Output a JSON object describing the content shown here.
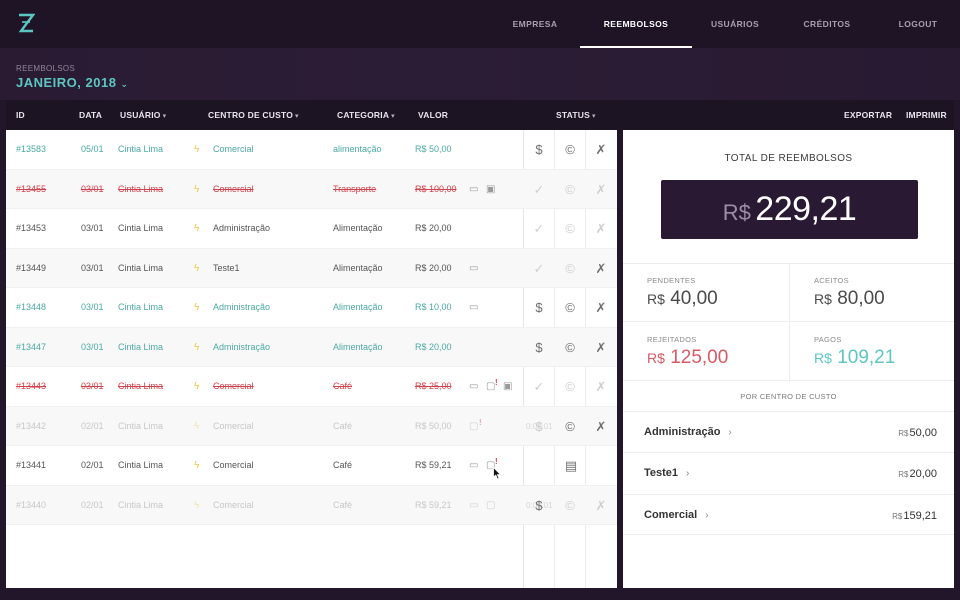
{
  "nav": {
    "items": [
      {
        "label": "EMPRESA",
        "active": false
      },
      {
        "label": "REEMBOLSOS",
        "active": true
      },
      {
        "label": "USUÁRIOS",
        "active": false
      },
      {
        "label": "CRÉDITOS",
        "active": false
      },
      {
        "label": "LOGOUT",
        "active": false
      }
    ]
  },
  "header": {
    "section": "REEMBOLSOS",
    "period": "JANEIRO, 2018"
  },
  "table": {
    "columns": {
      "id": "ID",
      "data": "DATA",
      "usuario": "USUÁRIO",
      "centro": "CENTRO DE CUSTO",
      "categoria": "CATEGORIA",
      "valor": "VALOR",
      "status": "STATUS"
    },
    "actions": {
      "export": "EXPORTAR",
      "print": "IMPRIMIR"
    },
    "rows": [
      {
        "id": "#13583",
        "date": "05/01",
        "user": "Cintia Lima",
        "cost_center": "Comercial",
        "category": "alimentação",
        "value": "R$ 50,00",
        "state": "pending"
      },
      {
        "id": "#13455",
        "date": "03/01",
        "user": "Cintia Lima",
        "cost_center": "Comercial",
        "category": "Transporte",
        "value": "R$ 100,00",
        "state": "rejected"
      },
      {
        "id": "#13453",
        "date": "03/01",
        "user": "Cintia Lima",
        "cost_center": "Administração",
        "category": "Alimentação",
        "value": "R$ 20,00",
        "state": "normal"
      },
      {
        "id": "#13449",
        "date": "03/01",
        "user": "Cintia Lima",
        "cost_center": "Teste1",
        "category": "Alimentação",
        "value": "R$ 20,00",
        "state": "normal"
      },
      {
        "id": "#13448",
        "date": "03/01",
        "user": "Cintia Lima",
        "cost_center": "Administração",
        "category": "Alimentação",
        "value": "R$ 10,00",
        "state": "pending"
      },
      {
        "id": "#13447",
        "date": "03/01",
        "user": "Cintia Lima",
        "cost_center": "Administração",
        "category": "Alimentação",
        "value": "R$ 20,00",
        "state": "pending"
      },
      {
        "id": "#13443",
        "date": "03/01",
        "user": "Cintia Lima",
        "cost_center": "Comercial",
        "category": "Café",
        "value": "R$ 25,00",
        "state": "rejected"
      },
      {
        "id": "#13442",
        "date": "02/01",
        "user": "Cintia Lima",
        "cost_center": "Comercial",
        "category": "Café",
        "value": "R$ 50,00",
        "state": "faded"
      },
      {
        "id": "#13441",
        "date": "02/01",
        "user": "Cintia Lima",
        "cost_center": "Comercial",
        "category": "Café",
        "value": "R$ 59,21",
        "state": "normal"
      },
      {
        "id": "#13440",
        "date": "02/01",
        "user": "Cintia Lima",
        "cost_center": "Comercial",
        "category": "Café",
        "value": "R$ 59,21",
        "state": "faded"
      }
    ],
    "faint_times": [
      "0:00:01",
      "0:00:01"
    ]
  },
  "summary": {
    "title": "TOTAL DE REEMBOLSOS",
    "currency": "R$",
    "total": "229,21",
    "stats": {
      "pendentes": {
        "label": "PENDENTES",
        "value": "40,00",
        "color": "#4a4a4a"
      },
      "aceitos": {
        "label": "ACEITOS",
        "value": "80,00",
        "color": "#4a4a4a"
      },
      "rejeitados": {
        "label": "REJEITADOS",
        "value": "125,00",
        "color": "#d85a64"
      },
      "pagos": {
        "label": "PAGOS",
        "value": "109,21",
        "color": "#5cc7c2"
      }
    },
    "by_cost_center_title": "POR CENTRO DE CUSTO",
    "cost_centers": [
      {
        "name": "Administração",
        "value": "50,00"
      },
      {
        "name": "Teste1",
        "value": "20,00"
      },
      {
        "name": "Comercial",
        "value": "159,21"
      }
    ]
  },
  "colors": {
    "accent": "#5cc7c2",
    "reject": "#d3434e",
    "dark": "#1f1426"
  }
}
